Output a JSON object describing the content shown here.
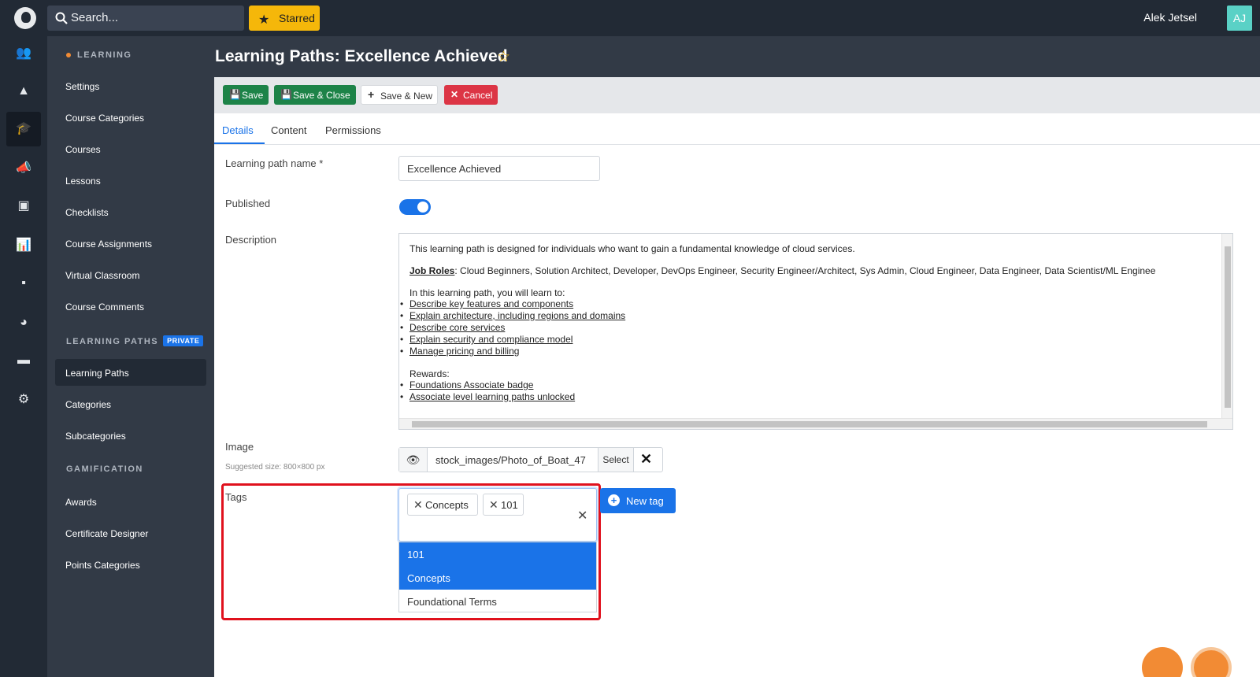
{
  "topbar": {
    "search_placeholder": "Search...",
    "starred_label": "Starred",
    "user_name": "Alek Jetsel",
    "user_initials": "AJ"
  },
  "rail": {
    "icons": [
      "users-icon",
      "shapes-icon",
      "graduation-cap-icon",
      "megaphone-icon",
      "money-icon",
      "chart-icon",
      "comment-icon",
      "palette-icon",
      "window-icon",
      "gear-icon"
    ],
    "active_index": 2
  },
  "sidebar": {
    "section_learning": "LEARNING",
    "learning_items": [
      "Settings",
      "Course Categories",
      "Courses",
      "Lessons",
      "Checklists",
      "Course Assignments",
      "Virtual Classroom",
      "Course Comments"
    ],
    "section_paths": "LEARNING PATHS",
    "private_badge": "PRIVATE",
    "paths_items": [
      "Learning Paths",
      "Categories",
      "Subcategories"
    ],
    "active_item": "Learning Paths",
    "section_gamification": "GAMIFICATION",
    "gamification_items": [
      "Awards",
      "Certificate Designer",
      "Points Categories"
    ]
  },
  "header": {
    "title": "Learning Paths: Excellence Achieved"
  },
  "toolbar": {
    "save_label": "Save",
    "save_close_label": "Save & Close",
    "save_new_label": "Save & New",
    "cancel_label": "Cancel"
  },
  "tabs": [
    "Details",
    "Content",
    "Permissions"
  ],
  "active_tab": "Details",
  "form": {
    "name_label": "Learning path name *",
    "name_value": "Excellence Achieved",
    "published_label": "Published",
    "published_on": true,
    "description_label": "Description",
    "description": {
      "intro": "This learning path is designed for individuals who want to gain a fundamental knowledge of cloud services.",
      "job_roles_label": "Job Roles",
      "job_roles_text": ": Cloud Beginners, Solution Architect, Developer, DevOps Engineer, Security Engineer/Architect, Sys Admin, Cloud Engineer, Data Engineer, Data Scientist/ML Enginee",
      "learn_intro": "In this learning path, you will learn to:",
      "learn_items": [
        "Describe key features and components",
        "Explain architecture, including regions and domains",
        "Describe core services",
        "Explain security and compliance model",
        "Manage pricing and billing"
      ],
      "rewards_label": "Rewards:",
      "reward_items": [
        "Foundations Associate badge",
        "Associate level learning paths unlocked"
      ]
    },
    "image_label": "Image",
    "image_hint": "Suggested size: 800×800 px",
    "image_path": "stock_images/Photo_of_Boat_47",
    "image_select_label": "Select",
    "tags_label": "Tags",
    "selected_tags": [
      "Concepts",
      "101"
    ],
    "tag_options": [
      {
        "label": "101",
        "selected": true
      },
      {
        "label": "Concepts",
        "selected": true
      },
      {
        "label": "Foundational Terms",
        "selected": false
      }
    ],
    "new_tag_label": "New tag"
  },
  "colors": {
    "accent": "#1a73e8",
    "save_green": "#1d8348",
    "cancel_red": "#dc3545",
    "starred_yellow": "#f5b70a",
    "highlight_red": "#e0111d"
  }
}
